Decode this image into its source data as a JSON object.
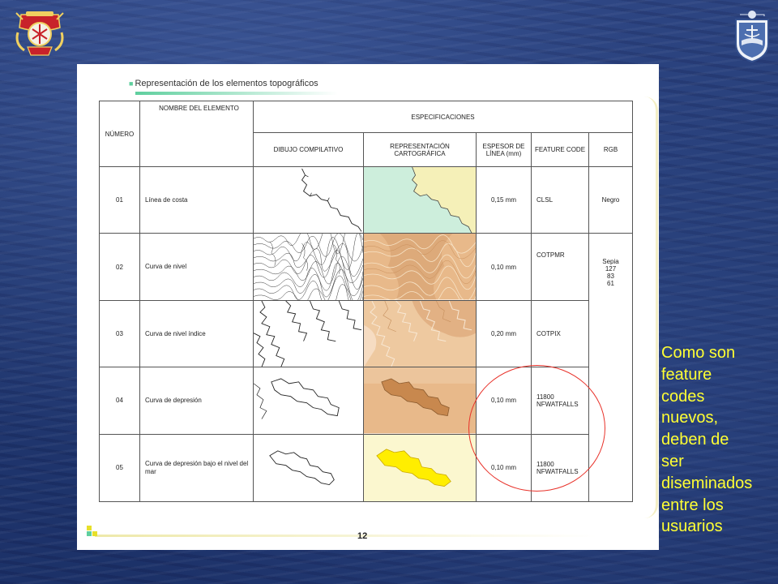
{
  "document": {
    "section_title": "Representación de los elementos topográficos",
    "page_number": "12",
    "table": {
      "headers": {
        "number": "NÚMERO",
        "element_name": "NOMBRE DEL ELEMENTO",
        "specifications": "ESPECIFICACIONES",
        "compilation_drawing": "DIBUJO COMPILATIVO",
        "cartographic_representation": "REPRESENTACIÓN CARTOGRÁFICA",
        "line_width": "ESPESOR DE LÍNEA (mm)",
        "feature_code": "FEATURE CODE",
        "rgb": "RGB"
      },
      "rows": [
        {
          "number": "01",
          "name": "Línea de costa",
          "line_width": "0,15 mm",
          "feature_code": "CLSL"
        },
        {
          "number": "02",
          "name": "Curva de nivel",
          "line_width": "0,10 mm",
          "feature_code": "COTPMR"
        },
        {
          "number": "03",
          "name": "Curva de nivel índice",
          "line_width": "0,20 mm",
          "feature_code": "COTPIX"
        },
        {
          "number": "04",
          "name": "Curva de depresión",
          "line_width": "0,10 mm",
          "feature_code": "11800 NFWATFALLS"
        },
        {
          "number": "05",
          "name": "Curva de depresión bajo el nivel del mar",
          "line_width": "0,10 mm",
          "feature_code": "11800 NFWATFALLS"
        }
      ],
      "rgb_values": {
        "row_01": "Negro",
        "rows_02_05": {
          "label": "Sepia",
          "r": "127",
          "g": "83",
          "b": "61"
        }
      }
    }
  },
  "annotation": {
    "lines": [
      "Como son",
      "feature",
      "codes",
      "nuevos,",
      "deben de",
      "ser",
      "diseminados",
      "entre los",
      "usuarios"
    ],
    "color": "#ffff33",
    "highlight_circle_color": "#e8322a"
  },
  "icons": [
    "navy-crest-icon",
    "hydrographic-shield-icon"
  ],
  "colors": {
    "background": "#233a73",
    "heading_accent": "#5fcf9e",
    "coast_water": "#cdeedc",
    "coast_land": "#f5f0b8",
    "sepia_fill": "#e8b98a",
    "below_sea_fill": "#ffee00"
  }
}
